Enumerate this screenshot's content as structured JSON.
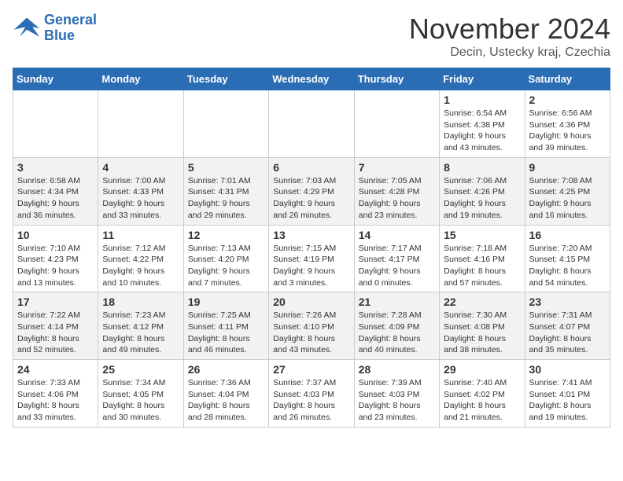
{
  "logo": {
    "line1": "General",
    "line2": "Blue"
  },
  "title": "November 2024",
  "subtitle": "Decin, Ustecky kraj, Czechia",
  "days_header": [
    "Sunday",
    "Monday",
    "Tuesday",
    "Wednesday",
    "Thursday",
    "Friday",
    "Saturday"
  ],
  "weeks": [
    [
      {
        "day": "",
        "info": ""
      },
      {
        "day": "",
        "info": ""
      },
      {
        "day": "",
        "info": ""
      },
      {
        "day": "",
        "info": ""
      },
      {
        "day": "",
        "info": ""
      },
      {
        "day": "1",
        "info": "Sunrise: 6:54 AM\nSunset: 4:38 PM\nDaylight: 9 hours and 43 minutes."
      },
      {
        "day": "2",
        "info": "Sunrise: 6:56 AM\nSunset: 4:36 PM\nDaylight: 9 hours and 39 minutes."
      }
    ],
    [
      {
        "day": "3",
        "info": "Sunrise: 6:58 AM\nSunset: 4:34 PM\nDaylight: 9 hours and 36 minutes."
      },
      {
        "day": "4",
        "info": "Sunrise: 7:00 AM\nSunset: 4:33 PM\nDaylight: 9 hours and 33 minutes."
      },
      {
        "day": "5",
        "info": "Sunrise: 7:01 AM\nSunset: 4:31 PM\nDaylight: 9 hours and 29 minutes."
      },
      {
        "day": "6",
        "info": "Sunrise: 7:03 AM\nSunset: 4:29 PM\nDaylight: 9 hours and 26 minutes."
      },
      {
        "day": "7",
        "info": "Sunrise: 7:05 AM\nSunset: 4:28 PM\nDaylight: 9 hours and 23 minutes."
      },
      {
        "day": "8",
        "info": "Sunrise: 7:06 AM\nSunset: 4:26 PM\nDaylight: 9 hours and 19 minutes."
      },
      {
        "day": "9",
        "info": "Sunrise: 7:08 AM\nSunset: 4:25 PM\nDaylight: 9 hours and 16 minutes."
      }
    ],
    [
      {
        "day": "10",
        "info": "Sunrise: 7:10 AM\nSunset: 4:23 PM\nDaylight: 9 hours and 13 minutes."
      },
      {
        "day": "11",
        "info": "Sunrise: 7:12 AM\nSunset: 4:22 PM\nDaylight: 9 hours and 10 minutes."
      },
      {
        "day": "12",
        "info": "Sunrise: 7:13 AM\nSunset: 4:20 PM\nDaylight: 9 hours and 7 minutes."
      },
      {
        "day": "13",
        "info": "Sunrise: 7:15 AM\nSunset: 4:19 PM\nDaylight: 9 hours and 3 minutes."
      },
      {
        "day": "14",
        "info": "Sunrise: 7:17 AM\nSunset: 4:17 PM\nDaylight: 9 hours and 0 minutes."
      },
      {
        "day": "15",
        "info": "Sunrise: 7:18 AM\nSunset: 4:16 PM\nDaylight: 8 hours and 57 minutes."
      },
      {
        "day": "16",
        "info": "Sunrise: 7:20 AM\nSunset: 4:15 PM\nDaylight: 8 hours and 54 minutes."
      }
    ],
    [
      {
        "day": "17",
        "info": "Sunrise: 7:22 AM\nSunset: 4:14 PM\nDaylight: 8 hours and 52 minutes."
      },
      {
        "day": "18",
        "info": "Sunrise: 7:23 AM\nSunset: 4:12 PM\nDaylight: 8 hours and 49 minutes."
      },
      {
        "day": "19",
        "info": "Sunrise: 7:25 AM\nSunset: 4:11 PM\nDaylight: 8 hours and 46 minutes."
      },
      {
        "day": "20",
        "info": "Sunrise: 7:26 AM\nSunset: 4:10 PM\nDaylight: 8 hours and 43 minutes."
      },
      {
        "day": "21",
        "info": "Sunrise: 7:28 AM\nSunset: 4:09 PM\nDaylight: 8 hours and 40 minutes."
      },
      {
        "day": "22",
        "info": "Sunrise: 7:30 AM\nSunset: 4:08 PM\nDaylight: 8 hours and 38 minutes."
      },
      {
        "day": "23",
        "info": "Sunrise: 7:31 AM\nSunset: 4:07 PM\nDaylight: 8 hours and 35 minutes."
      }
    ],
    [
      {
        "day": "24",
        "info": "Sunrise: 7:33 AM\nSunset: 4:06 PM\nDaylight: 8 hours and 33 minutes."
      },
      {
        "day": "25",
        "info": "Sunrise: 7:34 AM\nSunset: 4:05 PM\nDaylight: 8 hours and 30 minutes."
      },
      {
        "day": "26",
        "info": "Sunrise: 7:36 AM\nSunset: 4:04 PM\nDaylight: 8 hours and 28 minutes."
      },
      {
        "day": "27",
        "info": "Sunrise: 7:37 AM\nSunset: 4:03 PM\nDaylight: 8 hours and 26 minutes."
      },
      {
        "day": "28",
        "info": "Sunrise: 7:39 AM\nSunset: 4:03 PM\nDaylight: 8 hours and 23 minutes."
      },
      {
        "day": "29",
        "info": "Sunrise: 7:40 AM\nSunset: 4:02 PM\nDaylight: 8 hours and 21 minutes."
      },
      {
        "day": "30",
        "info": "Sunrise: 7:41 AM\nSunset: 4:01 PM\nDaylight: 8 hours and 19 minutes."
      }
    ]
  ]
}
